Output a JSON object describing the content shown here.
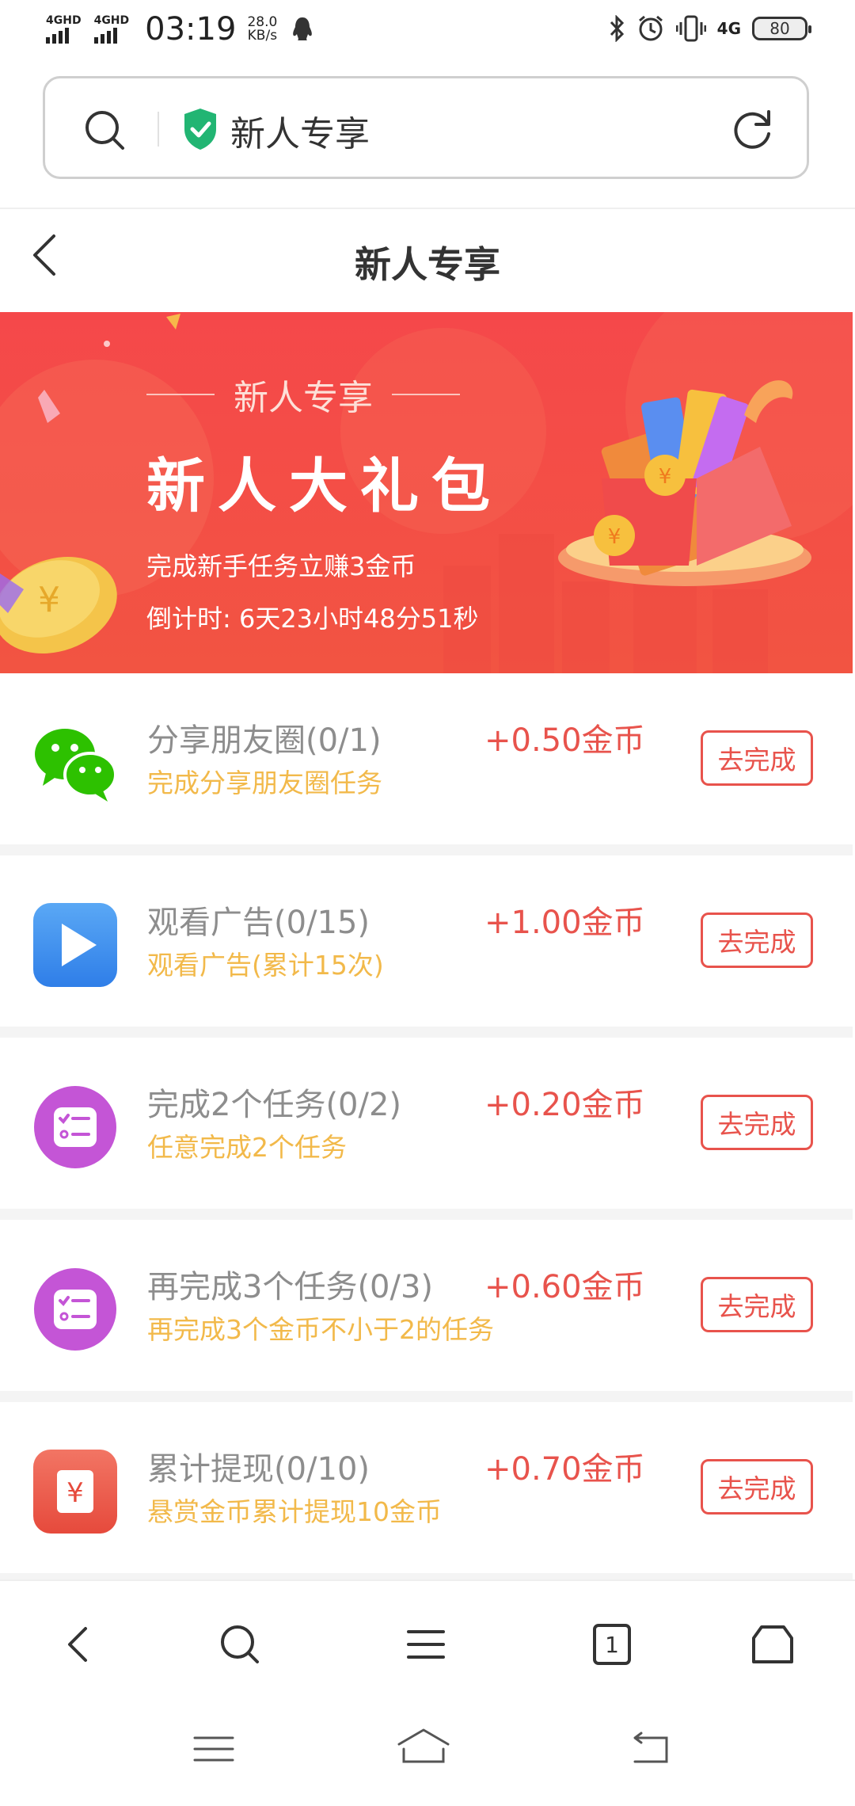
{
  "status_bar": {
    "network1": "4GHD",
    "network2": "4GHD",
    "time": "03:19",
    "speed_value": "28.0",
    "speed_unit": "KB/s",
    "network_type": "4G",
    "battery": "80"
  },
  "address_bar": {
    "text": "新人专享"
  },
  "header": {
    "title": "新人专享"
  },
  "banner": {
    "subtitle": "新人专享",
    "title": "新人大礼包",
    "line1": "完成新手任务立赚3金币",
    "line2": "倒计时: 6天23小时48分51秒"
  },
  "tasks": [
    {
      "name": "分享朋友圈(0/1)",
      "desc": "完成分享朋友圈任务",
      "reward": "+0.50金币",
      "button": "去完成",
      "icon": "wechat-icon"
    },
    {
      "name": "观看广告(0/15)",
      "desc": "观看广告(累计15次)",
      "reward": "+1.00金币",
      "button": "去完成",
      "icon": "video-play-icon"
    },
    {
      "name": "完成2个任务(0/2)",
      "desc": "任意完成2个任务",
      "reward": "+0.20金币",
      "button": "去完成",
      "icon": "task-list-icon"
    },
    {
      "name": "再完成3个任务(0/3)",
      "desc": "再完成3个金币不小于2的任务",
      "reward": "+0.60金币",
      "button": "去完成",
      "icon": "task-list-icon"
    },
    {
      "name": "累计提现(0/10)",
      "desc": "悬赏金币累计提现10金币",
      "reward": "+0.70金币",
      "button": "去完成",
      "icon": "yuan-withdraw-icon"
    }
  ],
  "bottom_nav": {
    "tab_count": "1"
  },
  "colors": {
    "accent": "#e8534c",
    "banner": "#f5484a",
    "desc": "#f2b94a"
  }
}
